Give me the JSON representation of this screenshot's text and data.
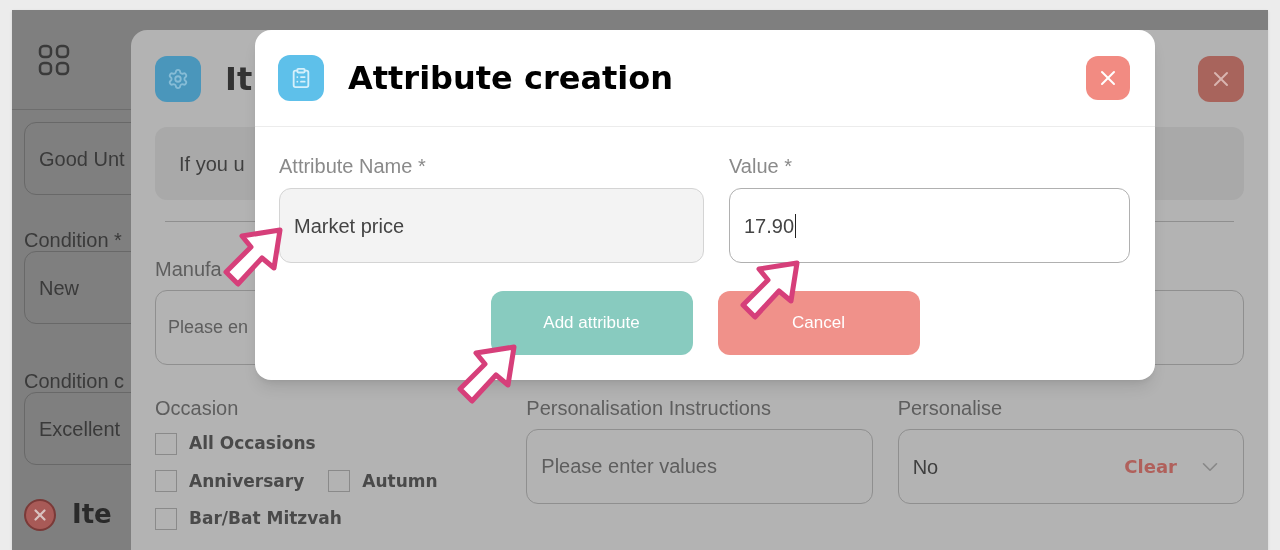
{
  "page": {
    "good_until_value": "Good Unt",
    "condition_label": "Condition *",
    "condition_value": "New",
    "condition_c_label": "Condition c",
    "condition_c_value": "Excellent",
    "section_title": "Ite"
  },
  "back_dialog": {
    "title": "It",
    "notice": "If you u",
    "manufacturer_label": "Manufa",
    "manufacturer_placeholder": "Please en",
    "occasion_label": "Occasion",
    "occasion_rows": [
      [
        {
          "label": "All Occasions",
          "checked": false
        }
      ],
      [
        {
          "label": "Anniversary",
          "checked": false
        },
        {
          "label": "Autumn",
          "checked": false
        }
      ],
      [
        {
          "label": "Bar/Bat Mitzvah",
          "checked": false
        }
      ]
    ],
    "instructions_label": "Personalisation Instructions",
    "instructions_placeholder": "Please enter values",
    "personalise_label": "Personalise",
    "personalise_value": "No",
    "clear": "Clear"
  },
  "dialog": {
    "title": "Attribute creation",
    "fields": [
      {
        "label": "Attribute Name *",
        "value": "Market price",
        "focused": false
      },
      {
        "label": "Value *",
        "value": "17.90",
        "focused": true
      }
    ],
    "buttons": [
      {
        "label": "Add attribute",
        "kind": "primary"
      },
      {
        "label": "Cancel",
        "kind": "secondary"
      }
    ]
  }
}
